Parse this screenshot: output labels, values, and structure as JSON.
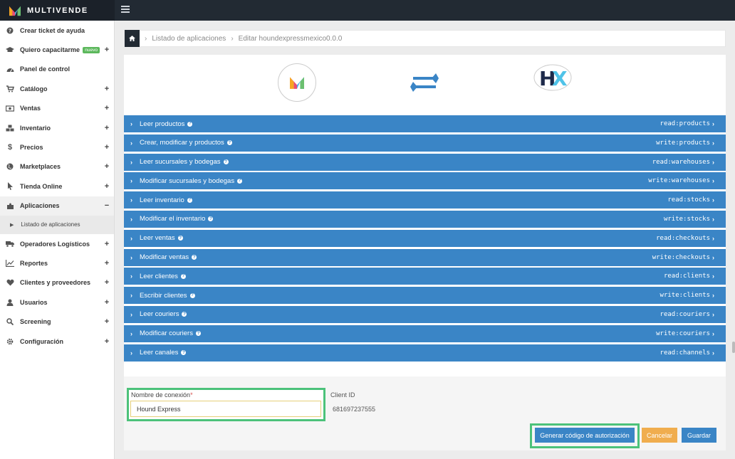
{
  "brand": {
    "name": "MULTIVENDE",
    "logo_icon": "multivende-logo-icon"
  },
  "sidebar": {
    "items": [
      {
        "label": "Crear ticket de ayuda",
        "icon": "question-circle-icon",
        "expandable": false
      },
      {
        "label": "Quiero capacitarme",
        "icon": "graduation-cap-icon",
        "badge": "nuevo",
        "expandable": true,
        "toggle": "+"
      },
      {
        "label": "Panel de control",
        "icon": "dashboard-icon",
        "expandable": false
      },
      {
        "label": "Catálogo",
        "icon": "cart-icon",
        "expandable": true,
        "toggle": "+"
      },
      {
        "label": "Ventas",
        "icon": "money-icon",
        "expandable": true,
        "toggle": "+"
      },
      {
        "label": "Inventario",
        "icon": "cubes-icon",
        "expandable": true,
        "toggle": "+"
      },
      {
        "label": "Precios",
        "icon": "dollar-icon",
        "expandable": true,
        "toggle": "+"
      },
      {
        "label": "Marketplaces",
        "icon": "globe-icon",
        "expandable": true,
        "toggle": "+"
      },
      {
        "label": "Tienda Online",
        "icon": "pointer-icon",
        "expandable": true,
        "toggle": "+"
      },
      {
        "label": "Aplicaciones",
        "icon": "puzzle-icon",
        "expandable": true,
        "toggle": "−",
        "active": true
      },
      {
        "label": "Operadores Logísticos",
        "icon": "truck-icon",
        "expandable": true,
        "toggle": "+"
      },
      {
        "label": "Reportes",
        "icon": "line-chart-icon",
        "expandable": true,
        "toggle": "+"
      },
      {
        "label": "Clientes y proveedores",
        "icon": "heart-icon",
        "expandable": true,
        "toggle": "+"
      },
      {
        "label": "Usuarios",
        "icon": "user-icon",
        "expandable": true,
        "toggle": "+"
      },
      {
        "label": "Screening",
        "icon": "search-icon",
        "expandable": true,
        "toggle": "+"
      },
      {
        "label": "Configuración",
        "icon": "gear-icon",
        "expandable": true,
        "toggle": "+"
      }
    ],
    "subitem": {
      "label": "Listado de aplicaciones"
    }
  },
  "breadcrumb": {
    "home_icon": "home-icon",
    "items": [
      "Listado de aplicaciones",
      "Editar houndexpressmexico0.0.0"
    ]
  },
  "permissions": [
    {
      "label": "Leer productos",
      "scope": "read:products"
    },
    {
      "label": "Crear, modificar y productos",
      "scope": "write:products"
    },
    {
      "label": "Leer sucursales y bodegas",
      "scope": "read:warehouses"
    },
    {
      "label": "Modificar sucursales y bodegas",
      "scope": "write:warehouses"
    },
    {
      "label": "Leer inventario",
      "scope": "read:stocks"
    },
    {
      "label": "Modificar el inventario",
      "scope": "write:stocks"
    },
    {
      "label": "Leer ventas",
      "scope": "read:checkouts"
    },
    {
      "label": "Modificar ventas",
      "scope": "write:checkouts"
    },
    {
      "label": "Leer clientes",
      "scope": "read:clients"
    },
    {
      "label": "Escribir clientes",
      "scope": "write:clients"
    },
    {
      "label": "Leer couriers",
      "scope": "read:couriers"
    },
    {
      "label": "Modificar couriers",
      "scope": "write:couriers"
    },
    {
      "label": "Leer canales",
      "scope": "read:channels"
    }
  ],
  "form": {
    "connection_label": "Nombre de conexión",
    "required_mark": "*",
    "connection_value": "Hound Express",
    "client_id_label": "Client ID",
    "client_id_value": "681697237555"
  },
  "buttons": {
    "generate": "Generar código de autorización",
    "cancel": "Cancelar",
    "save": "Guardar"
  },
  "colors": {
    "primary": "#3a85c6",
    "warning": "#f0ad4e",
    "highlight": "#4cc27a",
    "topbar": "#222a33"
  }
}
